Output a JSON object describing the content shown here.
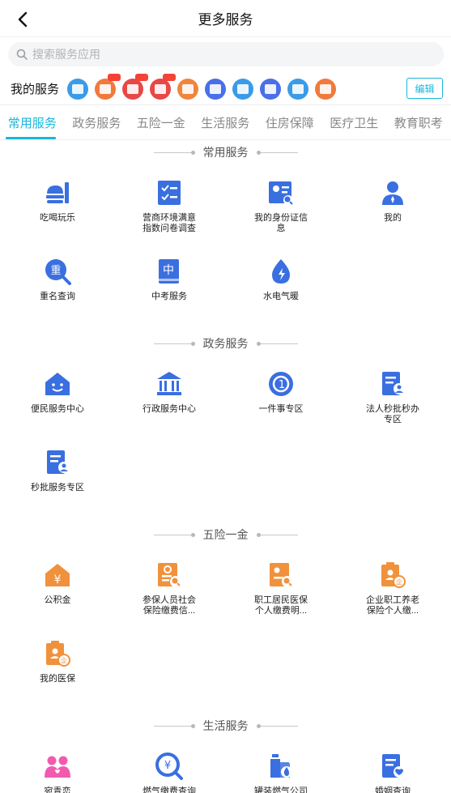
{
  "header": {
    "title": "更多服务"
  },
  "search": {
    "placeholder": "搜索服务应用"
  },
  "my_services": {
    "label": "我的服务",
    "edit_label": "编辑",
    "icons": [
      {
        "name": "home-mini-icon",
        "color": "#3a9be8",
        "badge": false
      },
      {
        "name": "ticket-mini-icon",
        "color": "#f07a3c",
        "badge": true
      },
      {
        "name": "heart-mini-icon",
        "color": "#e84747",
        "badge": true
      },
      {
        "name": "bank-mini-icon",
        "color": "#e84747",
        "badge": true
      },
      {
        "name": "house-mini-icon",
        "color": "#f0853c",
        "badge": false
      },
      {
        "name": "building-mini-icon",
        "color": "#4a6fe8",
        "badge": false
      },
      {
        "name": "card-mini-icon",
        "color": "#3a9be8",
        "badge": false
      },
      {
        "name": "search-mini-icon",
        "color": "#4a6fe8",
        "badge": false
      },
      {
        "name": "chs-mini-icon",
        "color": "#3a9be8",
        "badge": false
      },
      {
        "name": "office-mini-icon",
        "color": "#f07a3c",
        "badge": false
      }
    ]
  },
  "tabs": [
    {
      "label": "常用服务",
      "active": true
    },
    {
      "label": "政务服务",
      "active": false
    },
    {
      "label": "五险一金",
      "active": false
    },
    {
      "label": "生活服务",
      "active": false
    },
    {
      "label": "住房保障",
      "active": false
    },
    {
      "label": "医疗卫生",
      "active": false
    },
    {
      "label": "教育职考",
      "active": false
    }
  ],
  "colors": {
    "accent": "#19b6d9",
    "blue_icon": "#3a6fe0",
    "orange_icon": "#f0923c",
    "pink_icon": "#f25ab0"
  },
  "sections": [
    {
      "title": "常用服务",
      "items": [
        {
          "label": "吃喝玩乐",
          "icon": "food-icon"
        },
        {
          "label": "营商环境满意\n指数问卷调查",
          "icon": "checklist-icon"
        },
        {
          "label": "我的身份证信\n息",
          "icon": "id-card-icon"
        },
        {
          "label": "我的",
          "icon": "person-icon"
        },
        {
          "label": "重名查询",
          "icon": "name-search-icon"
        },
        {
          "label": "中考服务",
          "icon": "book-icon"
        },
        {
          "label": "水电气暖",
          "icon": "utility-icon"
        }
      ]
    },
    {
      "title": "政务服务",
      "items": [
        {
          "label": "便民服务中心",
          "icon": "home-smile-icon"
        },
        {
          "label": "行政服务中心",
          "icon": "government-icon"
        },
        {
          "label": "一件事专区",
          "icon": "one-icon"
        },
        {
          "label": "法人秒批秒办\n专区",
          "icon": "doc-person-icon"
        },
        {
          "label": "秒批服务专区",
          "icon": "doc-person-icon"
        }
      ]
    },
    {
      "title": "五险一金",
      "items": [
        {
          "label": "公积金",
          "icon": "fund-house-icon"
        },
        {
          "label": "参保人员社会\n保险缴费信...",
          "icon": "insurance-search-icon"
        },
        {
          "label": "职工居民医保\n个人缴费明...",
          "icon": "medical-doc-icon"
        },
        {
          "label": "企业职工养老\n保险个人缴...",
          "icon": "clipboard-person-icon"
        },
        {
          "label": "我的医保",
          "icon": "clipboard-person-icon"
        }
      ]
    },
    {
      "title": "生活服务",
      "items": [
        {
          "label": "宛青恋",
          "icon": "couple-icon"
        },
        {
          "label": "燃气缴费查询",
          "icon": "gas-search-icon"
        },
        {
          "label": "罐装燃气公司\n名单查询专区",
          "icon": "gas-tank-icon"
        },
        {
          "label": "婚姻查询",
          "icon": "marriage-doc-icon"
        }
      ]
    }
  ]
}
